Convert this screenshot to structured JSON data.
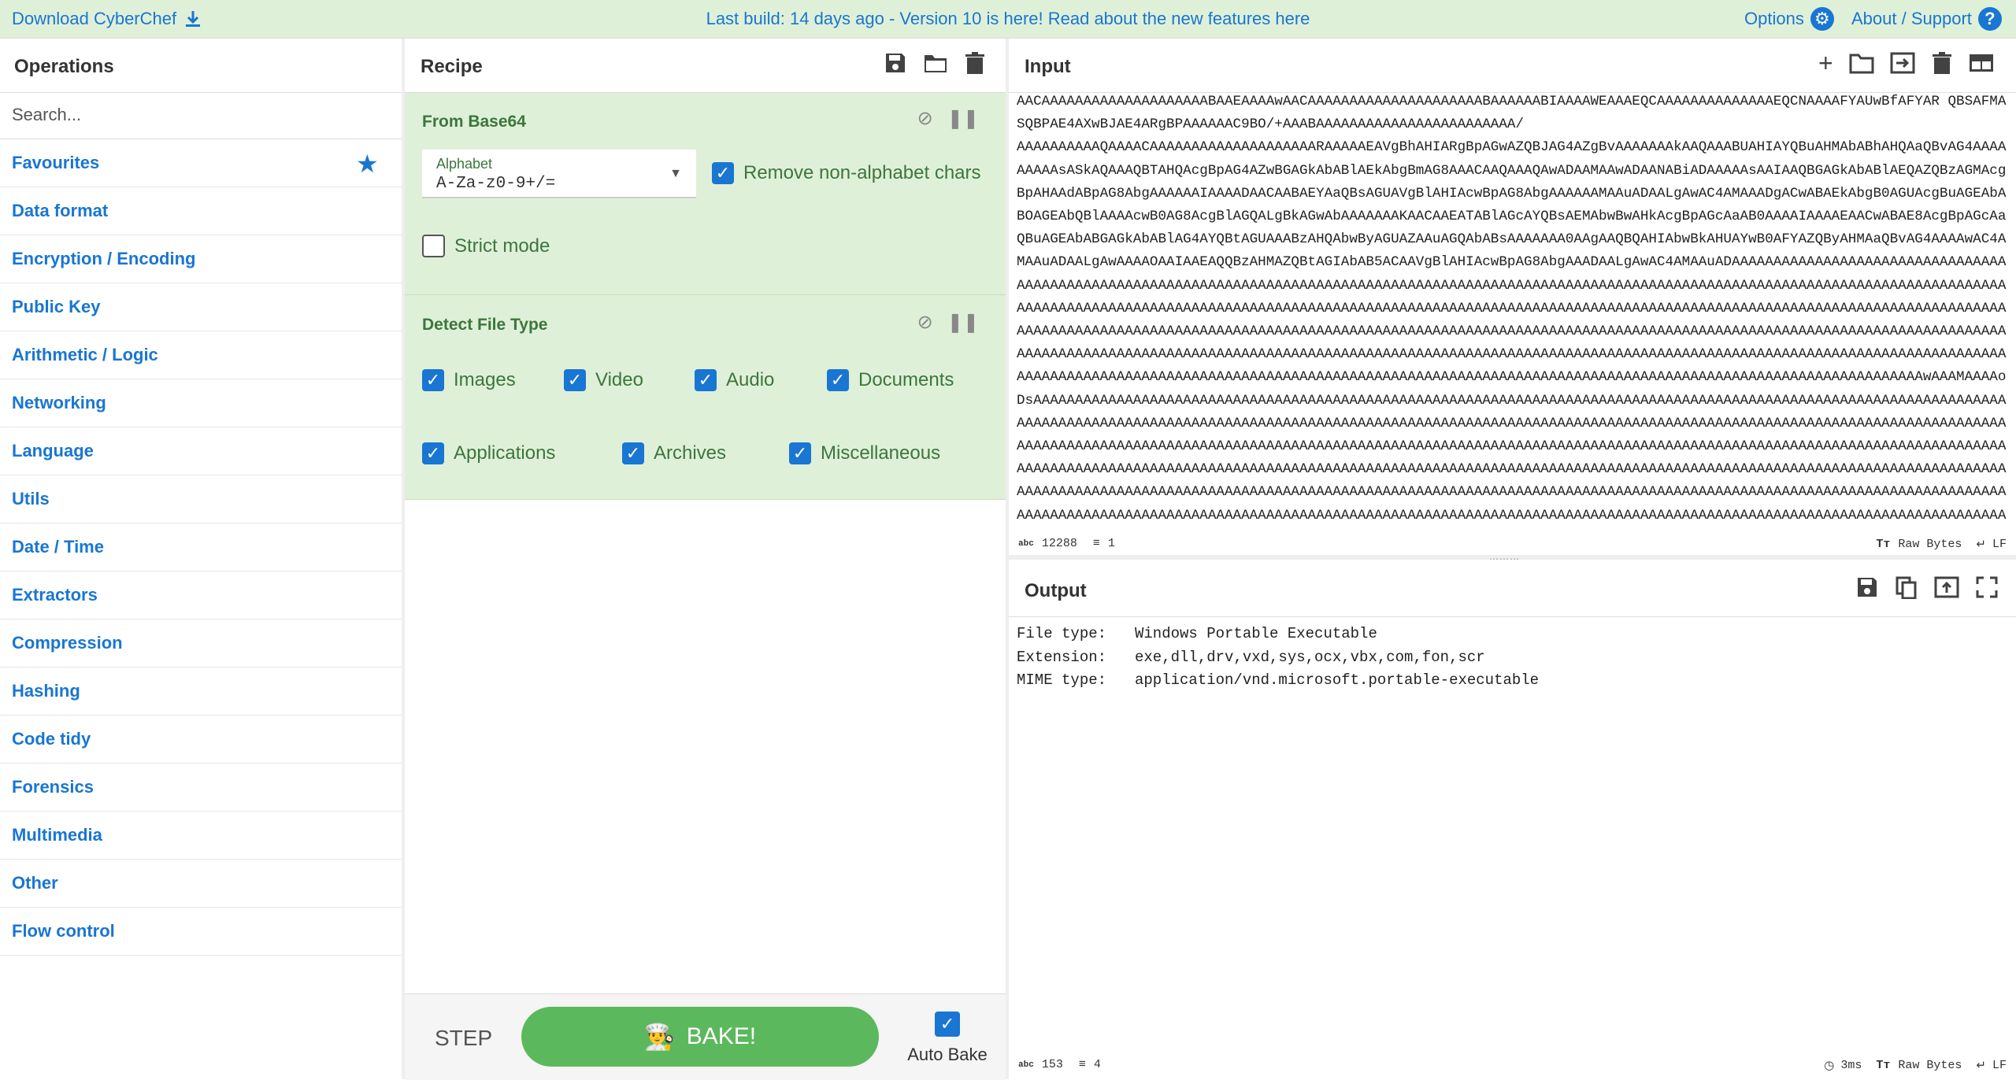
{
  "banner": {
    "download_label": "Download CyberChef",
    "notice": "Last build: 14 days ago - Version 10 is here! Read about the new features here",
    "options_label": "Options",
    "about_label": "About / Support"
  },
  "operations": {
    "title": "Operations",
    "search_placeholder": "Search...",
    "categories": [
      "Favourites",
      "Data format",
      "Encryption / Encoding",
      "Public Key",
      "Arithmetic / Logic",
      "Networking",
      "Language",
      "Utils",
      "Date / Time",
      "Extractors",
      "Compression",
      "Hashing",
      "Code tidy",
      "Forensics",
      "Multimedia",
      "Other",
      "Flow control"
    ]
  },
  "recipe": {
    "title": "Recipe",
    "from_base64": {
      "title": "From Base64",
      "alphabet_label": "Alphabet",
      "alphabet_value": "A-Za-z0-9+/=",
      "remove_label": "Remove non-alphabet chars",
      "strict_label": "Strict mode"
    },
    "detect": {
      "title": "Detect File Type",
      "images": "Images",
      "video": "Video",
      "audio": "Audio",
      "documents": "Documents",
      "applications": "Applications",
      "archives": "Archives",
      "misc": "Miscellaneous"
    },
    "step_label": "STEP",
    "bake_label": "BAKE!",
    "autobake_label": "Auto Bake"
  },
  "input": {
    "title": "Input",
    "text": "AACAAAAAAAAAAAAAAAAAAAABAAEAAAAwAACAAAAAAAAAAAAAAAAAAAAABAAAAAABIAAAAWEAAAEQCAAAAAAAAAAAAAAEQCNAAAAFYAUwBfAFYAR QBSAFMASQBPAE4AXwBJAE4ARgBPAAAAAAC9BO/+AAABAAAAAAAAAAAAAAAAAAAAAAAA/\nAAAAAAAAAAQAAAACAAAAAAAAAAAAAAAAAAAARAAAAAEAVgBhAHIARgBpAGwAZQBJAG4AZgBvAAAAAAAkAAQAAABUAHIAYQBuAHMAbABhAHQAaQBvAG4AAAAAAAAAsASkAQAAAQBTAHQAcgBpAG4AZwBGAGkAbABlAEkAbgBmAG8AAACAAQAAAQAwADAAMAAwADAANABiADAAAAAsAAIAAQBGAGkAbABlAEQAZQBzAGMAcgBpAHAAdABpAG8AbgAAAAAAIAAAADAACAABAEYAaQBsAGUAVgBlAHIAcwBpAG8AbgAAAAAAMAAuADAALgAwAC4AMAAADgACwABAEkAbgB0AGUAcgBuAGEAbABOAGEAbQBlAAAAcwB0AG8AcgBlAGQALgBkAGwAbAAAAAAAKAACAAEATABlAGcAYQBsAEMAbwBwAHkAcgBpAGcAaAB0AAAAIAAAAEAACwABAE8AcgBpAGcAaQBuAGEAbABGAGkAbABlAG4AYQBtAGUAAABzAHQAbwByAGUAZAAuAGQAbABsAAAAAAA0AAgAAQBQAHIAbwBkAHUAYwB0AFYAZQByAHMAaQBvAG4AAAAwAC4AMAAuADAALgAwAAAAOAAIAAEAQQBzAHMAZQBtAGIAbAB5ACAAVgBlAHIAcwBpAG8AbgAAADAALgAwAC4AMAAuADAAAAAAAAAAAAAAAAAAAAAAAAAAAAAAAAAAAAAAAAAAAAAAAAAAAAAAAAAAAAAAAAAAAAAAAAAAAAAAAAAAAAAAAAAAAAAAAAAAAAAAAAAAAAAAAAAAAAAAAAAAAAAAAAAAAAAAAAAAAAAAAAAAAAAAAAAAAAAAAAAAAAAAAAAAAAAAAAAAAAAAAAAAAAAAAAAAAAAAAAAAAAAAAAAAAAAAAAAAAAAAAAAAAAAAAAAAAAAAAAAAAAAAAAAAAAAAAAAAAAAAAAAAAAAAAAAAAAAAAAAAAAAAAAAAAAAAAAAAAAAAAAAAAAAAAAAAAAAAAAAAAAAAAAAAAAAAAAAAAAAAAAAAAAAAAAAAAAAAAAAAAAAAAAAAAAAAAAAAAAAAAAAAAAAAAAAAAAAAAAAAAAAAAAAAAAAAAAAAAAAAAAAAAAAAAAAAAAAAAAAAAAAAAAAAAAAAAAAAAAAAAAAAAAAAAAAAAAAAAAAAAAAAAAAAAAAAAAAAAAAAAAAAAAAAAAAAAAAAAAAAAAAAAAAAAAAAAAAAAAAAAAAAAAAAAAAAAAAAAAAAAAAAAAAAAAAAAAAAAAAAAAAAAAAAAAAAAAAAAAAAAAAAAAAAAAAAAAAAwAAAMAAAAoDsAAAAAAAAAAAAAAAAAAAAAAAAAAAAAAAAAAAAAAAAAAAAAAAAAAAAAAAAAAAAAAAAAAAAAAAAAAAAAAAAAAAAAAAAAAAAAAAAAAAAAAAAAAAAAAAAAAAAAAAAAAAAAAAAAAAAAAAAAAAAAAAAAAAAAAAAAAAAAAAAAAAAAAAAAAAAAAAAAAAAAAAAAAAAAAAAAAAAAAAAAAAAAAAAAAAAAAAAAAAAAAAAAAAAAAAAAAAAAAAAAAAAAAAAAAAAAAAAAAAAAAAAAAAAAAAAAAAAAAAAAAAAAAAAAAAAAAAAAAAAAAAAAAAAAAAAAAAAAAAAAAAAAAAAAAAAAAAAAAAAAAAAAAAAAAAAAAAAAAAAAAAAAAAAAAAAAAAAAAAAAAAAAAAAAAAAAAAAAAAAAAAAAAAAAAAAAAAAAAAAAAAAAAAAAAAAAAAAAAAAAAAAAAAAAAAAAAAAAAAAAAAAAAAAAAAAAAAAAAAAAAAAAAAAAAAAAAAAAAAAAAAAAAAAAAAAAAAAAAAAAAAAAAAAAAAAAAAAAAAAAAAAAAAAAAAAAAAAAAAAAAAAAAAAAAAAAAAAAAAAAAAAAAAAAAAAAAAAAAAAAAAAAAAAAAAAAAAAAAAAAAAAAAAAAAAAAAAAAAAAAAAAAAAAAAAAAAAAAAAAAAAAAAAAAAAAAAAAAAAAAAAAAAAAAAAAAAAAAAAAAAAAAAAAAAAAAAAAAAAAAAAAAAAAAAAAAAAAAAAAAAAAAAAAAAAAAAAAAAAAAAAAAAAAAAAAAAAAAAAAAAAAAAAAAAAAAAAAAAAAAAAAAAAAAAAAAAAA",
    "status_length": "12288",
    "status_lines": "1",
    "raw_bytes": "Raw Bytes",
    "eol": "LF"
  },
  "output": {
    "title": "Output",
    "rows": [
      {
        "key": "File type:",
        "val": "Windows Portable Executable"
      },
      {
        "key": "Extension:",
        "val": "exe,dll,drv,vxd,sys,ocx,vbx,com,fon,scr"
      },
      {
        "key": "MIME type:",
        "val": "application/vnd.microsoft.portable-executable"
      }
    ],
    "status_length": "153",
    "status_lines": "4",
    "time": "3ms",
    "raw_bytes": "Raw Bytes",
    "eol": "LF"
  },
  "colors": {
    "accent": "#1976d2",
    "recipe_green": "#dff0d8",
    "bake_green": "#5cb85c",
    "label_green": "#3c763d"
  }
}
